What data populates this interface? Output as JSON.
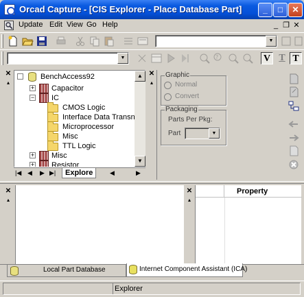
{
  "window": {
    "title": "Orcad Capture - [CIS Explorer - Place Database Part]",
    "controls": {
      "minimize": "_",
      "maximize": "□",
      "close": "✕"
    }
  },
  "menu": {
    "items": [
      "Update",
      "Edit",
      "View",
      "Go",
      "Help"
    ],
    "mdi_controls": {
      "minimize": "_",
      "restore": "❐",
      "close": "✕"
    }
  },
  "tree": {
    "root": "BenchAccess92",
    "items": [
      {
        "label": "Capacitor",
        "level": 1,
        "icon": "library-icon",
        "expander": "+"
      },
      {
        "label": "IC",
        "level": 1,
        "icon": "library-icon",
        "expander": "−"
      },
      {
        "label": "CMOS Logic",
        "level": 2,
        "icon": "folder-icon"
      },
      {
        "label": "Interface Data Transn",
        "level": 2,
        "icon": "folder-icon"
      },
      {
        "label": "Microprocessor",
        "level": 2,
        "icon": "folder-icon"
      },
      {
        "label": "Misc",
        "level": 2,
        "icon": "folder-icon"
      },
      {
        "label": "TTL Logic",
        "level": 2,
        "icon": "folder-icon"
      },
      {
        "label": "Misc",
        "level": 1,
        "icon": "library-icon",
        "expander": "+"
      },
      {
        "label": "Resistor",
        "level": 1,
        "icon": "library-icon",
        "expander": "+"
      }
    ],
    "tab_label": "Explore"
  },
  "graphic": {
    "group_label": "Graphic",
    "options": [
      "Normal",
      "Convert"
    ]
  },
  "packaging": {
    "group_label": "Packaging",
    "parts_per_pkg_label": "Parts Per Pkg:",
    "part_label": "Part"
  },
  "property_panel": {
    "header": "Property"
  },
  "bottom_tabs": {
    "local": "Local Part Database",
    "ica": "Internet Component Assistant (ICA)"
  },
  "status": {
    "text": "Explorer"
  },
  "colors": {
    "title_blue": "#0550d8",
    "face": "#d4d0c8",
    "close_red": "#c2401c"
  }
}
